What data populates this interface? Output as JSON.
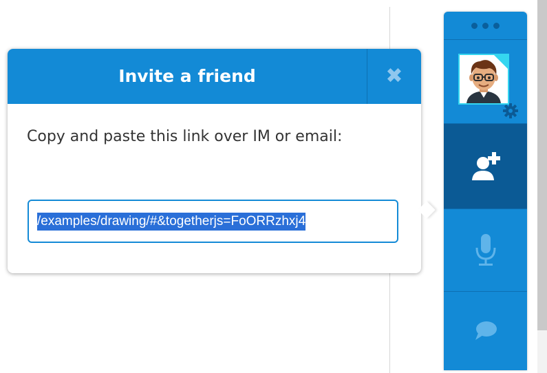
{
  "colors": {
    "accent": "#138ad6",
    "dock_active": "#0b5a95",
    "dock_icon_muted": "#5fb4ea",
    "selection": "#2a6fd8"
  },
  "dock": {
    "handle_icon": "more-dots-icon",
    "avatar_icon": "avatar",
    "settings_icon": "gear-icon",
    "invite_icon": "add-user-icon",
    "mic_icon": "microphone-icon",
    "chat_icon": "chat-bubble-icon"
  },
  "invite_popup": {
    "title": "Invite a friend",
    "close_glyph": "✖",
    "instructions": "Copy and paste this link over IM or email:",
    "link_value": "/examples/drawing/#&togetherjs=FoORRzhxj4"
  }
}
